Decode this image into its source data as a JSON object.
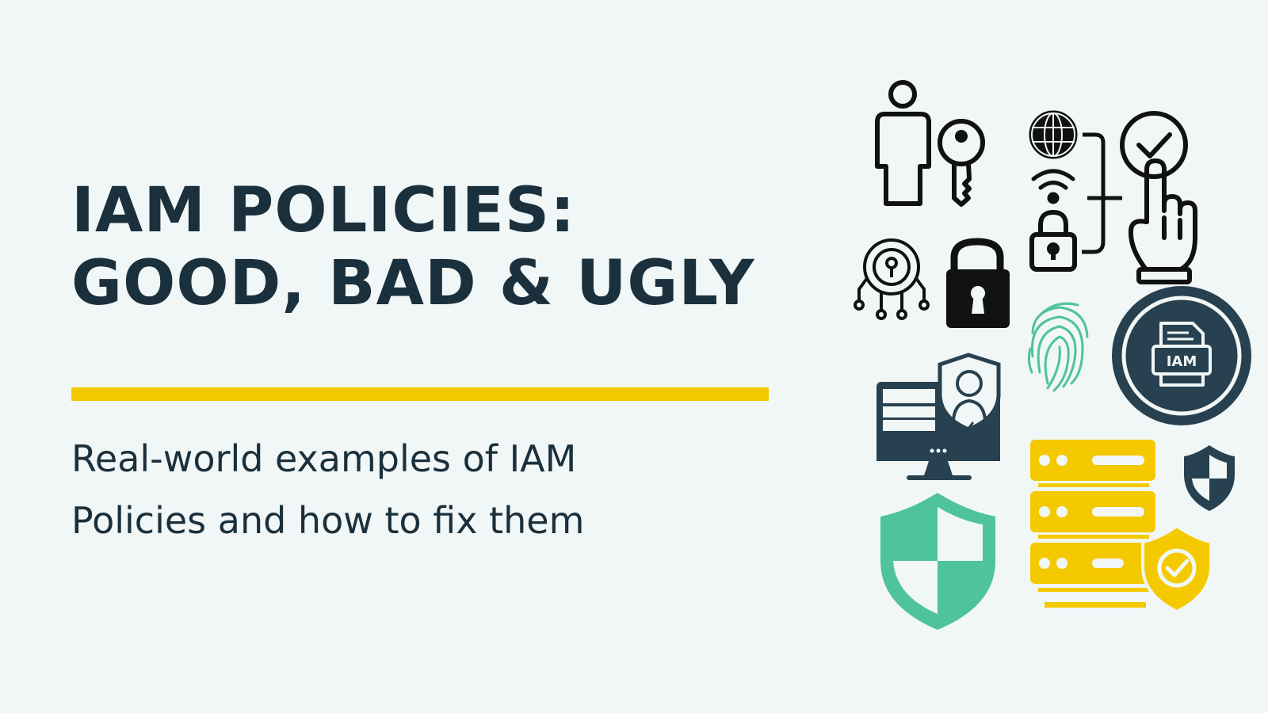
{
  "headline": {
    "line1": "IAM POLICIES:",
    "line2": "GOOD, BAD & UGLY"
  },
  "subtitle": {
    "line1": "Real-world examples of IAM",
    "line2": "Policies and how to fix them"
  },
  "illustration": {
    "document_badge_text": "IAM",
    "icons": [
      "user-icon",
      "key-icon",
      "globe-icon",
      "wifi-icon",
      "padlock-icon",
      "check-circle-icon",
      "pointing-hand-icon",
      "keyhole-chip-icon",
      "black-lock-icon",
      "fingerprint-icon",
      "iam-document-badge-icon",
      "monitor-admin-icon",
      "shield-icon",
      "server-rack-icon",
      "small-shield-icon",
      "shield-check-icon"
    ]
  },
  "colors": {
    "background": "#f1f7f6",
    "text": "#1a303c",
    "accent_yellow": "#f5c900",
    "accent_green": "#4fc39a",
    "dark_slate": "#274150"
  }
}
